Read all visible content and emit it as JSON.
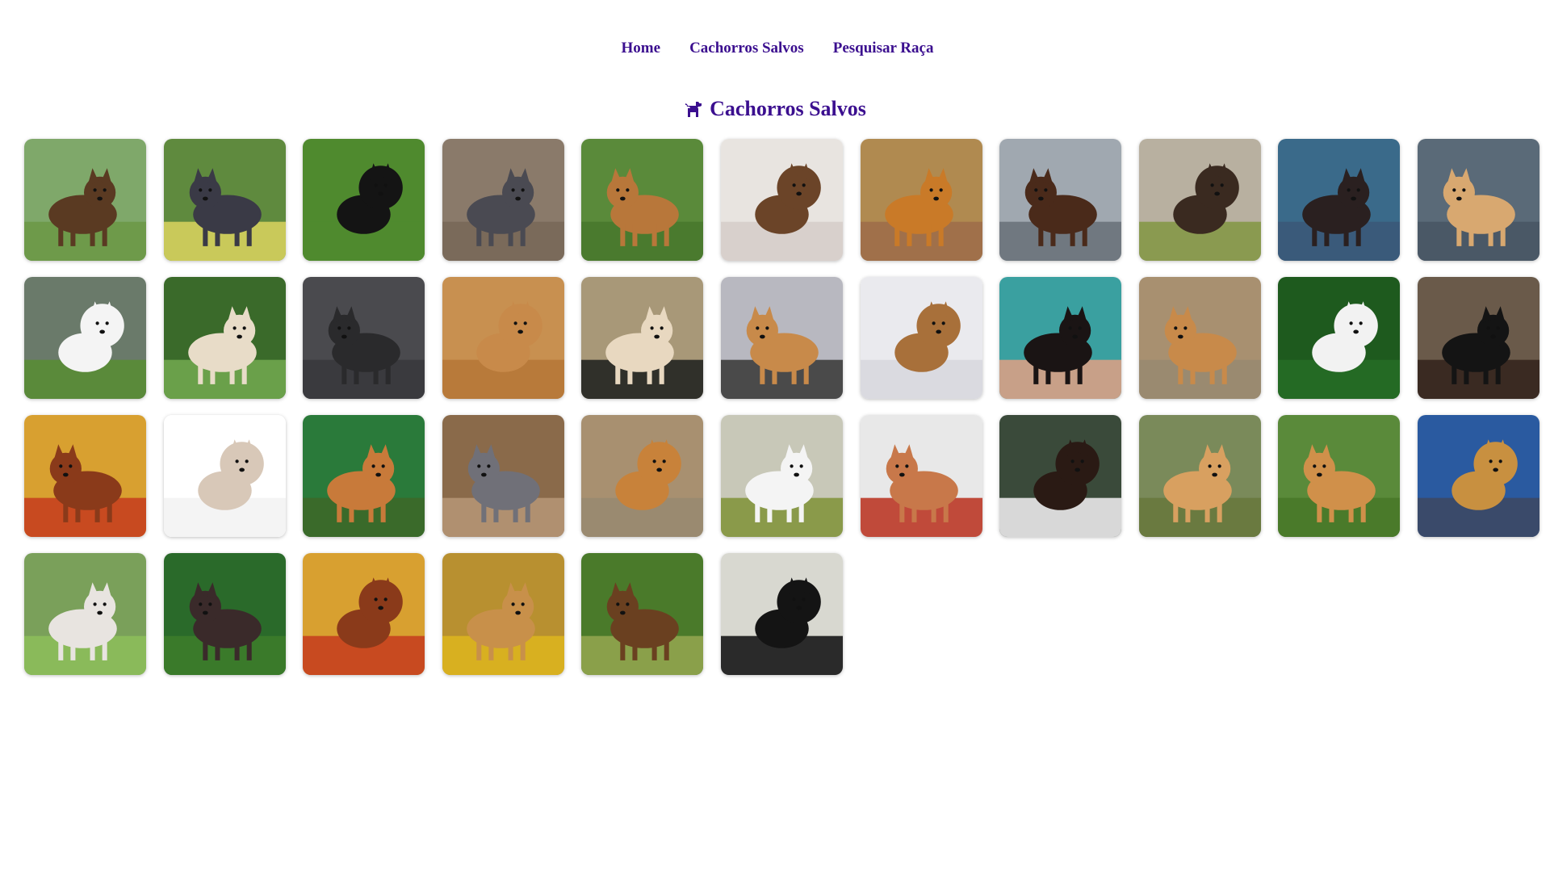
{
  "nav": {
    "items": [
      {
        "label": "Home"
      },
      {
        "label": "Cachorros Salvos"
      },
      {
        "label": "Pesquisar Raça"
      }
    ]
  },
  "page": {
    "title": "Cachorros Salvos",
    "icon": "dog-icon",
    "accent_color": "#3b0f8f"
  },
  "dogs": [
    {
      "bg": "#7fa86a",
      "fur": "#5a3a22",
      "ground": "#6e9a4a"
    },
    {
      "bg": "#5f8a3e",
      "fur": "#3a3a46",
      "ground": "#c9c95a"
    },
    {
      "bg": "#4f8a2e",
      "fur": "#141414",
      "ground": "#4f8a2e"
    },
    {
      "bg": "#8a7a6a",
      "fur": "#4a4a52",
      "ground": "#7a6a5a"
    },
    {
      "bg": "#5a8a3a",
      "fur": "#b8773a",
      "ground": "#4a7a2e"
    },
    {
      "bg": "#e8e4e0",
      "fur": "#6b4428",
      "ground": "#d8d0cc"
    },
    {
      "bg": "#b08a50",
      "fur": "#c97a28",
      "ground": "#a0704a"
    },
    {
      "bg": "#a0a8b0",
      "fur": "#4a2a1a",
      "ground": "#707880"
    },
    {
      "bg": "#b8b0a0",
      "fur": "#3a2a20",
      "ground": "#8a9a50"
    },
    {
      "bg": "#3a6a8a",
      "fur": "#2a2020",
      "ground": "#3a5a7a"
    },
    {
      "bg": "#5a6a78",
      "fur": "#d8a870",
      "ground": "#4a5866"
    },
    {
      "bg": "#6a7a6a",
      "fur": "#f4f4f4",
      "ground": "#5a8a3a"
    },
    {
      "bg": "#3a6a2a",
      "fur": "#e8dcc8",
      "ground": "#6aa04a"
    },
    {
      "bg": "#4a4a4e",
      "fur": "#2a2a2c",
      "ground": "#3a3a3e"
    },
    {
      "bg": "#c89050",
      "fur": "#c88a4a",
      "ground": "#b87a3a"
    },
    {
      "bg": "#a89878",
      "fur": "#e8d8c0",
      "ground": "#30302a"
    },
    {
      "bg": "#b8b8c0",
      "fur": "#c88a4a",
      "ground": "#4a4a4a"
    },
    {
      "bg": "#eaeaee",
      "fur": "#a8703a",
      "ground": "#dadae0"
    },
    {
      "bg": "#3aa0a0",
      "fur": "#1a1414",
      "ground": "#c8a088"
    },
    {
      "bg": "#a89070",
      "fur": "#c88a4a",
      "ground": "#9a8a70"
    },
    {
      "bg": "#1e5a1e",
      "fur": "#f2f2f2",
      "ground": "#246a24"
    },
    {
      "bg": "#6a5a4a",
      "fur": "#141414",
      "ground": "#3a2a22"
    },
    {
      "bg": "#d8a030",
      "fur": "#8a3a1a",
      "ground": "#c84a20"
    },
    {
      "bg": "#ffffff",
      "fur": "#d8c8b8",
      "ground": "#f4f4f4"
    },
    {
      "bg": "#2a7a3a",
      "fur": "#c87a3a",
      "ground": "#3a6a2a"
    },
    {
      "bg": "#8a6a4a",
      "fur": "#707078",
      "ground": "#b09070"
    },
    {
      "bg": "#a89070",
      "fur": "#c8823a",
      "ground": "#9a8a70"
    },
    {
      "bg": "#c8c8b8",
      "fur": "#f4f4f4",
      "ground": "#8a9a4a"
    },
    {
      "bg": "#e8e8e8",
      "fur": "#c8784a",
      "ground": "#c04a3a"
    },
    {
      "bg": "#3a4a3a",
      "fur": "#2a1a14",
      "ground": "#d8d8d8"
    },
    {
      "bg": "#7a8a5a",
      "fur": "#d8a060",
      "ground": "#6a7a40"
    },
    {
      "bg": "#5a8a3a",
      "fur": "#d0904a",
      "ground": "#4a7a2a"
    },
    {
      "bg": "#2a5aa0",
      "fur": "#c89040",
      "ground": "#3a4a6a"
    },
    {
      "bg": "#7aa05a",
      "fur": "#e8e4e0",
      "ground": "#8aba5a"
    },
    {
      "bg": "#2a6a2a",
      "fur": "#3a2a2a",
      "ground": "#3a7a2a"
    },
    {
      "bg": "#d8a030",
      "fur": "#8a3a1a",
      "ground": "#c84a20"
    },
    {
      "bg": "#b89030",
      "fur": "#c8904a",
      "ground": "#d8b020"
    },
    {
      "bg": "#4a7a2a",
      "fur": "#6a4020",
      "ground": "#8aa04a"
    },
    {
      "bg": "#d8d8d0",
      "fur": "#141414",
      "ground": "#2a2a2a"
    }
  ]
}
